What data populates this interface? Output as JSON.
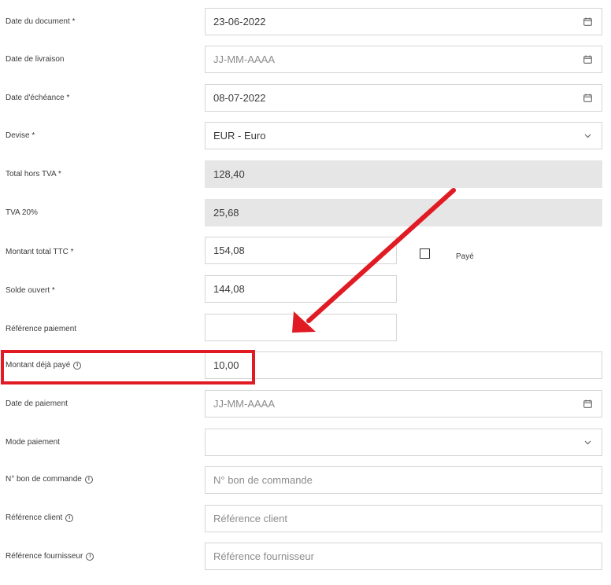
{
  "form": {
    "date_document": {
      "label": "Date du document *",
      "value": "23-06-2022",
      "placeholder": ""
    },
    "date_livraison": {
      "label": "Date de livraison",
      "value": "",
      "placeholder": "JJ-MM-AAAA"
    },
    "date_echeance": {
      "label": "Date d'échéance *",
      "value": "08-07-2022",
      "placeholder": ""
    },
    "devise": {
      "label": "Devise *",
      "value": "EUR - Euro"
    },
    "total_hors_tva": {
      "label": "Total hors TVA *",
      "value": "128,40"
    },
    "tva": {
      "label": "TVA 20%",
      "value": "25,68"
    },
    "montant_total_ttc": {
      "label": "Montant total TTC *",
      "value": "154,08"
    },
    "paye": {
      "label": "Payé",
      "checked": false
    },
    "solde_ouvert": {
      "label": "Solde ouvert *",
      "value": "144,08"
    },
    "reference_paiement": {
      "label": "Référence paiement",
      "value": ""
    },
    "montant_deja_paye": {
      "label": "Montant déjà payé",
      "value": "10,00"
    },
    "date_paiement": {
      "label": "Date de paiement",
      "value": "",
      "placeholder": "JJ-MM-AAAA"
    },
    "mode_paiement": {
      "label": "Mode paiement",
      "value": ""
    },
    "bon_commande": {
      "label": "N° bon de commande",
      "value": "",
      "placeholder": "N° bon de commande"
    },
    "reference_client": {
      "label": "Référence client",
      "value": "",
      "placeholder": "Référence client"
    },
    "reference_fournisseur": {
      "label": "Référence fournisseur",
      "value": "",
      "placeholder": "Référence fournisseur"
    }
  },
  "icons": {
    "calendar": "calendar-icon",
    "chevron": "chevron-down-icon",
    "info": "info-icon"
  },
  "annotations": {
    "highlight_color": "#e01b24",
    "arrow_color": "#e01b24"
  }
}
